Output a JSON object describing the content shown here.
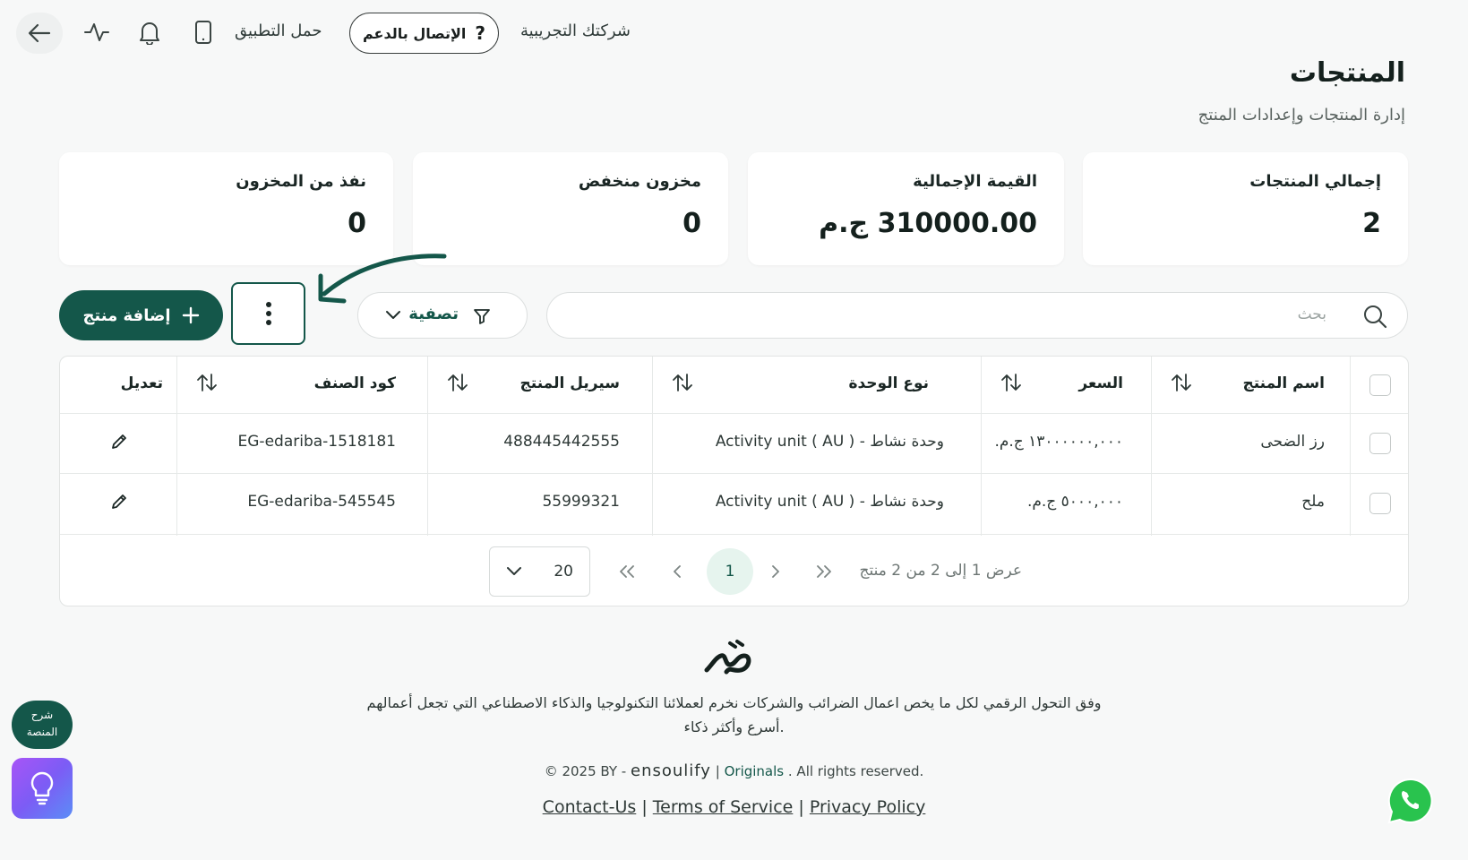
{
  "topbar": {
    "company": "شركتك التجريبية",
    "support": "الإتصال بالدعم",
    "app": "حمل التطبيق"
  },
  "page": {
    "title": "المنتجات",
    "subtitle": "إدارة المنتجات وإعدادات المنتج"
  },
  "stats": [
    {
      "label": "إجمالي المنتجات",
      "value": "2"
    },
    {
      "label": "القيمة الإجمالية",
      "value": "310000.00 ج.م"
    },
    {
      "label": "مخزون منخفض",
      "value": "0"
    },
    {
      "label": "نفذ من المخزون",
      "value": "0"
    }
  ],
  "toolbar": {
    "search_placeholder": "بحث",
    "filter": "تصفية",
    "add": "إضافة منتج"
  },
  "table": {
    "headers": {
      "name": "اسم المنتج",
      "price": "السعر",
      "unit": "نوع الوحدة",
      "serial": "سيريل المنتج",
      "sku": "كود الصنف",
      "edit": "تعديل"
    },
    "rows": [
      {
        "name": "رز الضحى",
        "price": "١٣٠٠٠٠٠٠,٠٠٠ ج.م.",
        "unit": "وحدة نشاط - ( Activity unit ( AU",
        "serial": "488445442555",
        "sku": "EG-edariba-1518181"
      },
      {
        "name": "ملح",
        "price": "٥٠٠٠,٠٠٠ ج.م.",
        "unit": "وحدة نشاط - ( Activity unit ( AU",
        "serial": "55999321",
        "sku": "EG-edariba-545545"
      }
    ]
  },
  "pagination": {
    "page_size": "20",
    "current": "1",
    "info": "عرض 1 إلى 2 من 2 منتج"
  },
  "footer": {
    "tagline_1": "وفق التحول الرقمي لكل ما يخص اعمال الضرائب والشركات نخرم لعملائنا التكنولوجيا والذكاء الاصطناعي التي تجعل أعمالهم",
    "tagline_2": "أسرع وأكثر ذكاء.",
    "copy_prefix": "© 2025 BY -",
    "brand": "ensoulify",
    "separator": "|",
    "originals": "Originals",
    "rights": ". All rights reserved.",
    "link_contact": "Contact-Us",
    "link_terms": "Terms of Service",
    "link_privacy": "Privacy Policy"
  },
  "float": {
    "explain_1": "شرح",
    "explain_2": "المنصة"
  },
  "colors": {
    "primary": "#14574a",
    "background": "#f7f8f8",
    "card": "#ffffff"
  }
}
